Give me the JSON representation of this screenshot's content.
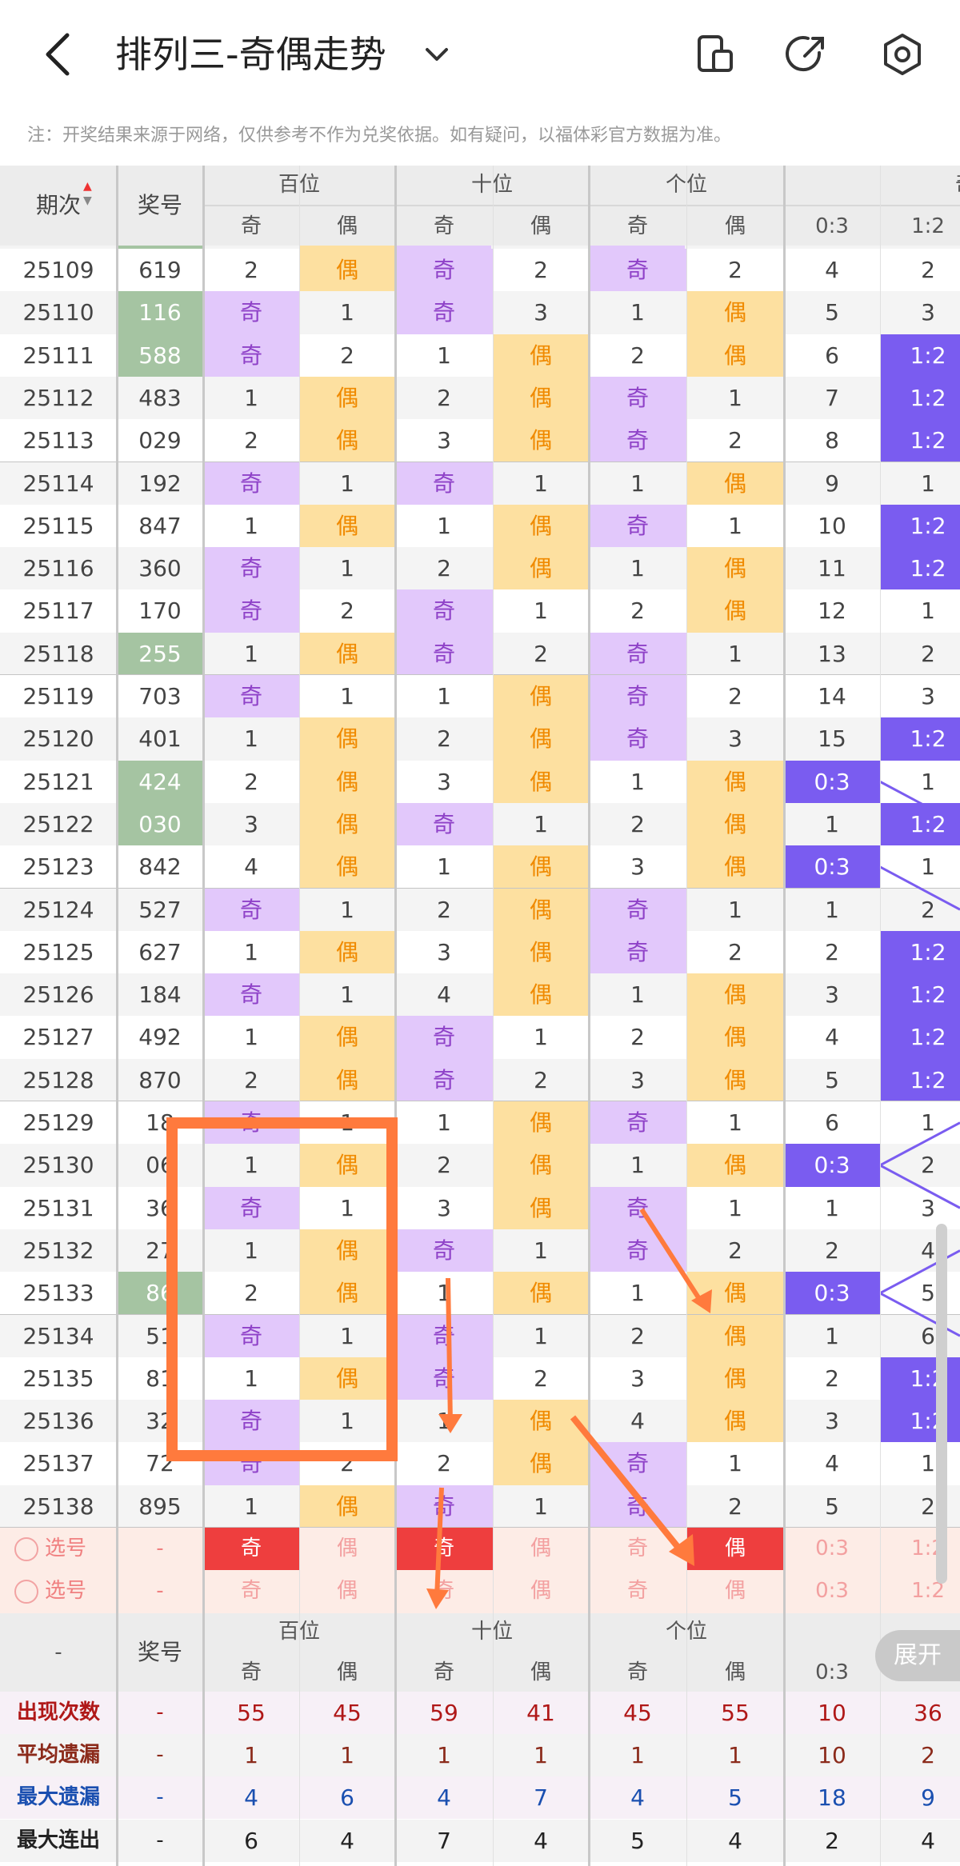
{
  "header": {
    "title": "排列三-奇偶走势",
    "notice": "注：开奖结果来源于网络，仅供参考不作为兑奖依据。如有疑问，以福体彩官方数据为准。"
  },
  "columns": {
    "period": "期次",
    "award": "奖号",
    "groups": [
      "百位",
      "十位",
      "个位"
    ],
    "odd": "奇",
    "even": "偶",
    "ratio_group_partial": "奇",
    "ratios": [
      "0:3",
      "1:2"
    ]
  },
  "rows": [
    {
      "p": "25109",
      "n": "619",
      "ng": false,
      "b": [
        "2",
        "偶"
      ],
      "s": [
        "奇",
        "2"
      ],
      "g": [
        "奇",
        "2"
      ],
      "r0": "4",
      "r1": "2"
    },
    {
      "p": "25110",
      "n": "116",
      "ng": true,
      "b": [
        "奇",
        "1"
      ],
      "s": [
        "奇",
        "3"
      ],
      "g": [
        "1",
        "偶"
      ],
      "r0": "5",
      "r1": "3"
    },
    {
      "p": "25111",
      "n": "588",
      "ng": true,
      "b": [
        "奇",
        "2"
      ],
      "s": [
        "1",
        "偶"
      ],
      "g": [
        "2",
        "偶"
      ],
      "r0": "6",
      "r1": "1:2"
    },
    {
      "p": "25112",
      "n": "483",
      "ng": false,
      "b": [
        "1",
        "偶"
      ],
      "s": [
        "2",
        "偶"
      ],
      "g": [
        "奇",
        "1"
      ],
      "r0": "7",
      "r1": "1:2"
    },
    {
      "p": "25113",
      "n": "029",
      "ng": false,
      "b": [
        "2",
        "偶"
      ],
      "s": [
        "3",
        "偶"
      ],
      "g": [
        "奇",
        "2"
      ],
      "r0": "8",
      "r1": "1:2"
    },
    {
      "p": "25114",
      "n": "192",
      "ng": false,
      "b": [
        "奇",
        "1"
      ],
      "s": [
        "奇",
        "1"
      ],
      "g": [
        "1",
        "偶"
      ],
      "r0": "9",
      "r1": "1"
    },
    {
      "p": "25115",
      "n": "847",
      "ng": false,
      "b": [
        "1",
        "偶"
      ],
      "s": [
        "1",
        "偶"
      ],
      "g": [
        "奇",
        "1"
      ],
      "r0": "10",
      "r1": "1:2"
    },
    {
      "p": "25116",
      "n": "360",
      "ng": false,
      "b": [
        "奇",
        "1"
      ],
      "s": [
        "2",
        "偶"
      ],
      "g": [
        "1",
        "偶"
      ],
      "r0": "11",
      "r1": "1:2"
    },
    {
      "p": "25117",
      "n": "170",
      "ng": false,
      "b": [
        "奇",
        "2"
      ],
      "s": [
        "奇",
        "1"
      ],
      "g": [
        "2",
        "偶"
      ],
      "r0": "12",
      "r1": "1"
    },
    {
      "p": "25118",
      "n": "255",
      "ng": true,
      "b": [
        "1",
        "偶"
      ],
      "s": [
        "奇",
        "2"
      ],
      "g": [
        "奇",
        "1"
      ],
      "r0": "13",
      "r1": "2"
    },
    {
      "p": "25119",
      "n": "703",
      "ng": false,
      "b": [
        "奇",
        "1"
      ],
      "s": [
        "1",
        "偶"
      ],
      "g": [
        "奇",
        "2"
      ],
      "r0": "14",
      "r1": "3"
    },
    {
      "p": "25120",
      "n": "401",
      "ng": false,
      "b": [
        "1",
        "偶"
      ],
      "s": [
        "2",
        "偶"
      ],
      "g": [
        "奇",
        "3"
      ],
      "r0": "15",
      "r1": "1:2"
    },
    {
      "p": "25121",
      "n": "424",
      "ng": true,
      "b": [
        "2",
        "偶"
      ],
      "s": [
        "3",
        "偶"
      ],
      "g": [
        "1",
        "偶"
      ],
      "r0": "0:3",
      "r1": "1"
    },
    {
      "p": "25122",
      "n": "030",
      "ng": true,
      "b": [
        "3",
        "偶"
      ],
      "s": [
        "奇",
        "1"
      ],
      "g": [
        "2",
        "偶"
      ],
      "r0": "1",
      "r1": "1:2"
    },
    {
      "p": "25123",
      "n": "842",
      "ng": false,
      "b": [
        "4",
        "偶"
      ],
      "s": [
        "1",
        "偶"
      ],
      "g": [
        "3",
        "偶"
      ],
      "r0": "0:3",
      "r1": "1"
    },
    {
      "p": "25124",
      "n": "527",
      "ng": false,
      "b": [
        "奇",
        "1"
      ],
      "s": [
        "2",
        "偶"
      ],
      "g": [
        "奇",
        "1"
      ],
      "r0": "1",
      "r1": "2"
    },
    {
      "p": "25125",
      "n": "627",
      "ng": false,
      "b": [
        "1",
        "偶"
      ],
      "s": [
        "3",
        "偶"
      ],
      "g": [
        "奇",
        "2"
      ],
      "r0": "2",
      "r1": "1:2"
    },
    {
      "p": "25126",
      "n": "184",
      "ng": false,
      "b": [
        "奇",
        "1"
      ],
      "s": [
        "4",
        "偶"
      ],
      "g": [
        "1",
        "偶"
      ],
      "r0": "3",
      "r1": "1:2"
    },
    {
      "p": "25127",
      "n": "492",
      "ng": false,
      "b": [
        "1",
        "偶"
      ],
      "s": [
        "奇",
        "1"
      ],
      "g": [
        "2",
        "偶"
      ],
      "r0": "4",
      "r1": "1:2"
    },
    {
      "p": "25128",
      "n": "870",
      "ng": false,
      "b": [
        "2",
        "偶"
      ],
      "s": [
        "奇",
        "2"
      ],
      "g": [
        "3",
        "偶"
      ],
      "r0": "5",
      "r1": "1:2"
    },
    {
      "p": "25129",
      "n": "18",
      "ng": false,
      "b": [
        "奇",
        "1"
      ],
      "s": [
        "1",
        "偶"
      ],
      "g": [
        "奇",
        "1"
      ],
      "r0": "6",
      "r1": "1"
    },
    {
      "p": "25130",
      "n": "06",
      "ng": false,
      "b": [
        "1",
        "偶"
      ],
      "s": [
        "2",
        "偶"
      ],
      "g": [
        "1",
        "偶"
      ],
      "r0": "0:3",
      "r1": "2"
    },
    {
      "p": "25131",
      "n": "36",
      "ng": false,
      "b": [
        "奇",
        "1"
      ],
      "s": [
        "3",
        "偶"
      ],
      "g": [
        "奇",
        "1"
      ],
      "r0": "1",
      "r1": "3"
    },
    {
      "p": "25132",
      "n": "27",
      "ng": false,
      "b": [
        "1",
        "偶"
      ],
      "s": [
        "奇",
        "1"
      ],
      "g": [
        "奇",
        "2"
      ],
      "r0": "2",
      "r1": "4"
    },
    {
      "p": "25133",
      "n": "86",
      "ng": true,
      "b": [
        "2",
        "偶"
      ],
      "s": [
        "1",
        "偶"
      ],
      "g": [
        "1",
        "偶"
      ],
      "r0": "0:3",
      "r1": "5"
    },
    {
      "p": "25134",
      "n": "51",
      "ng": false,
      "b": [
        "奇",
        "1"
      ],
      "s": [
        "奇",
        "1"
      ],
      "g": [
        "2",
        "偶"
      ],
      "r0": "1",
      "r1": "6"
    },
    {
      "p": "25135",
      "n": "81",
      "ng": false,
      "b": [
        "1",
        "偶"
      ],
      "s": [
        "奇",
        "2"
      ],
      "g": [
        "3",
        "偶"
      ],
      "r0": "2",
      "r1": "1:2"
    },
    {
      "p": "25136",
      "n": "32",
      "ng": false,
      "b": [
        "奇",
        "1"
      ],
      "s": [
        "1",
        "偶"
      ],
      "g": [
        "4",
        "偶"
      ],
      "r0": "3",
      "r1": "1:2"
    },
    {
      "p": "25137",
      "n": "72",
      "ng": false,
      "b": [
        "奇",
        "2"
      ],
      "s": [
        "2",
        "偶"
      ],
      "g": [
        "奇",
        "1"
      ],
      "r0": "4",
      "r1": "1"
    },
    {
      "p": "25138",
      "n": "895",
      "ng": false,
      "b": [
        "1",
        "偶"
      ],
      "s": [
        "奇",
        "1"
      ],
      "g": [
        "奇",
        "2"
      ],
      "r0": "5",
      "r1": "2"
    }
  ],
  "select_rows": [
    {
      "label": "选号",
      "award": "-",
      "cells": [
        "奇",
        "偶",
        "奇",
        "偶",
        "奇",
        "偶",
        "0:3",
        "1:2"
      ]
    },
    {
      "label": "选号",
      "award": "-",
      "cells": [
        "奇",
        "偶",
        "奇",
        "偶",
        "奇",
        "偶",
        "0:3",
        "1:2"
      ]
    }
  ],
  "footer_header": {
    "dash": "-",
    "award": "奖号",
    "groups": [
      "百位",
      "十位",
      "个位"
    ],
    "odd": "奇",
    "even": "偶",
    "ratios": [
      "0:3",
      "1:2"
    ]
  },
  "stats": [
    {
      "label": "出现次数",
      "award": "-",
      "vals": [
        "55",
        "45",
        "59",
        "41",
        "45",
        "55",
        "10",
        "36"
      ],
      "color": "#b01818"
    },
    {
      "label": "平均遗漏",
      "award": "-",
      "vals": [
        "1",
        "1",
        "1",
        "1",
        "1",
        "1",
        "10",
        "2"
      ],
      "color": "#8b2a1a"
    },
    {
      "label": "最大遗漏",
      "award": "-",
      "vals": [
        "4",
        "6",
        "4",
        "7",
        "4",
        "5",
        "18",
        "9"
      ],
      "color": "#1a4fb0"
    },
    {
      "label": "最大连出",
      "award": "-",
      "vals": [
        "6",
        "4",
        "7",
        "4",
        "5",
        "4",
        "2",
        "4"
      ],
      "color": "#222222"
    }
  ],
  "expand_label": "展开",
  "colors": {
    "odd_bg": "#e2c8fb",
    "even_bg": "#fde0a0",
    "ratio_bg": "#7a5cf0",
    "highlight_red": "#ee3e3e",
    "annotation": "#ff7a3d"
  }
}
